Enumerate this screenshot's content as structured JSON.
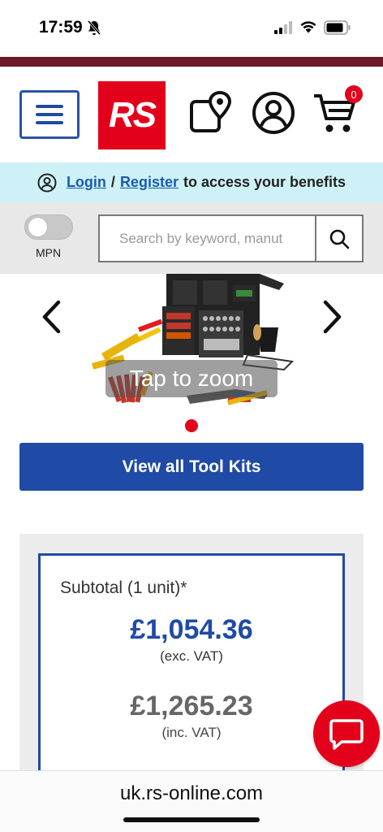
{
  "status_bar": {
    "time": "17:59"
  },
  "header": {
    "logo_text": "RS",
    "cart_count": "0"
  },
  "login_bar": {
    "login": "Login",
    "separator": "/",
    "register": "Register",
    "tail": "to access your benefits"
  },
  "search": {
    "toggle_label": "MPN",
    "placeholder": "Search by keyword, manut"
  },
  "gallery": {
    "zoom_label": "Tap to zoom"
  },
  "view_all_button": "View all Tool Kits",
  "pricing": {
    "subtotal_label": "Subtotal (1 unit)*",
    "price_exc": "£1,054.36",
    "price_exc_note": "(exc. VAT)",
    "price_inc": "£1,265.23",
    "price_inc_note": "(inc. VAT)"
  },
  "browser": {
    "url": "uk.rs-online.com"
  },
  "colors": {
    "brand_red": "#e3001b",
    "brand_blue": "#1f4aa6",
    "stripe": "#6b1a26",
    "login_bar": "#cdf1f6"
  }
}
